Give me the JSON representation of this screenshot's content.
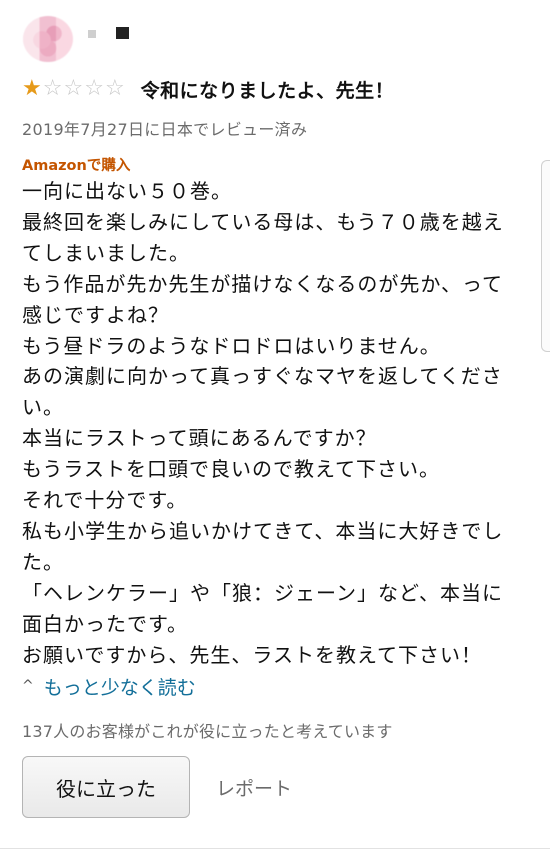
{
  "review": {
    "stars": [
      true,
      false,
      false,
      false,
      false
    ],
    "star_filled_glyph": "★",
    "star_empty_glyph": "☆",
    "title": "令和になりましたよ、先生！",
    "date": "2019年7月27日に日本でレビュー済み",
    "verified_label": "Amazonで購入",
    "body_lines": [
      "一向に出ない５０巻。",
      "最終回を楽しみにしている母は、もう７０歳を越え",
      "てしまいました。",
      "もう作品が先か先生が描けなくなるのが先か、って",
      "感じですよね？",
      "もう昼ドラのようなドロドロはいりません。",
      "あの演劇に向かって真っすぐなマヤを返してくださ",
      "い。",
      "本当にラストって頭にあるんですか？",
      "もうラストを口頭で良いので教えて下さい。",
      "それで十分です。",
      "私も小学生から追いかけてきて、本当に大好きでし",
      "た。",
      "「ヘレンケラー」や「狼：ジェーン」など、本当に",
      "面白かったです。",
      "お願いですから、先生、ラストを教えて下さい！"
    ],
    "read_less_label": "もっと少なく読む",
    "read_less_icon": "chevron-up",
    "helpful_count_text": "137人のお客様がこれが役に立ったと考えています",
    "helpful_button_label": "役に立った",
    "report_label": "レポート"
  },
  "colors": {
    "star": "#e69a1a",
    "verified": "#c45500",
    "link": "#136f99",
    "muted": "#6b6b6b"
  }
}
